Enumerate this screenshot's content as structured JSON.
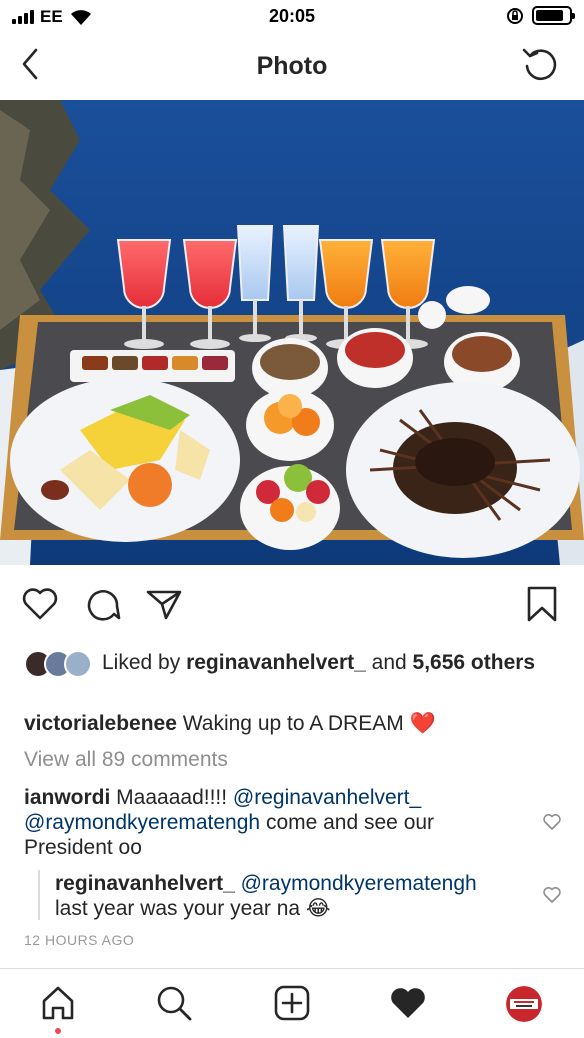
{
  "status_bar": {
    "carrier": "EE",
    "time": "20:05",
    "battery_level": 0.85
  },
  "nav": {
    "title": "Photo",
    "back_icon": "chevron-left-icon",
    "refresh_icon": "refresh-icon"
  },
  "photo": {
    "alt": "Breakfast tray with juices, fruit, pancakes overlooking the sea"
  },
  "actions": {
    "like_icon": "heart-outline-icon",
    "comment_icon": "comment-icon",
    "share_icon": "paper-plane-icon",
    "save_icon": "bookmark-icon"
  },
  "likes": {
    "prefix": "Liked by ",
    "user": "reginavanhelvert_",
    "middle": " and ",
    "count": "5,656 others"
  },
  "caption": {
    "username": "victorialebenee",
    "text": " Waking up to A DREAM ",
    "emoji": "❤️"
  },
  "view_all_comments": "View all 89 comments",
  "comments": [
    {
      "username": "ianwordi",
      "text1": " Maaaaad!!!! ",
      "mention1": "@reginavanhelvert_",
      "mention2": "@raymondkyerematengh",
      "text2": " come and see our President oo"
    },
    {
      "username": "reginavanhelvert_",
      "mention": "@raymondkyerematengh",
      "text": "last year was your year na ",
      "emoji": "😂"
    }
  ],
  "timestamp": "12 HOURS AGO",
  "colors": {
    "accent_red": "#ed4956",
    "link_blue": "#003569",
    "muted_gray": "#8e8e8e",
    "text": "#262626"
  },
  "tab_bar": {
    "home_icon": "home-icon",
    "search_icon": "search-icon",
    "add_icon": "add-post-icon",
    "activity_icon": "heart-filled-icon",
    "profile_icon": "profile-avatar"
  }
}
